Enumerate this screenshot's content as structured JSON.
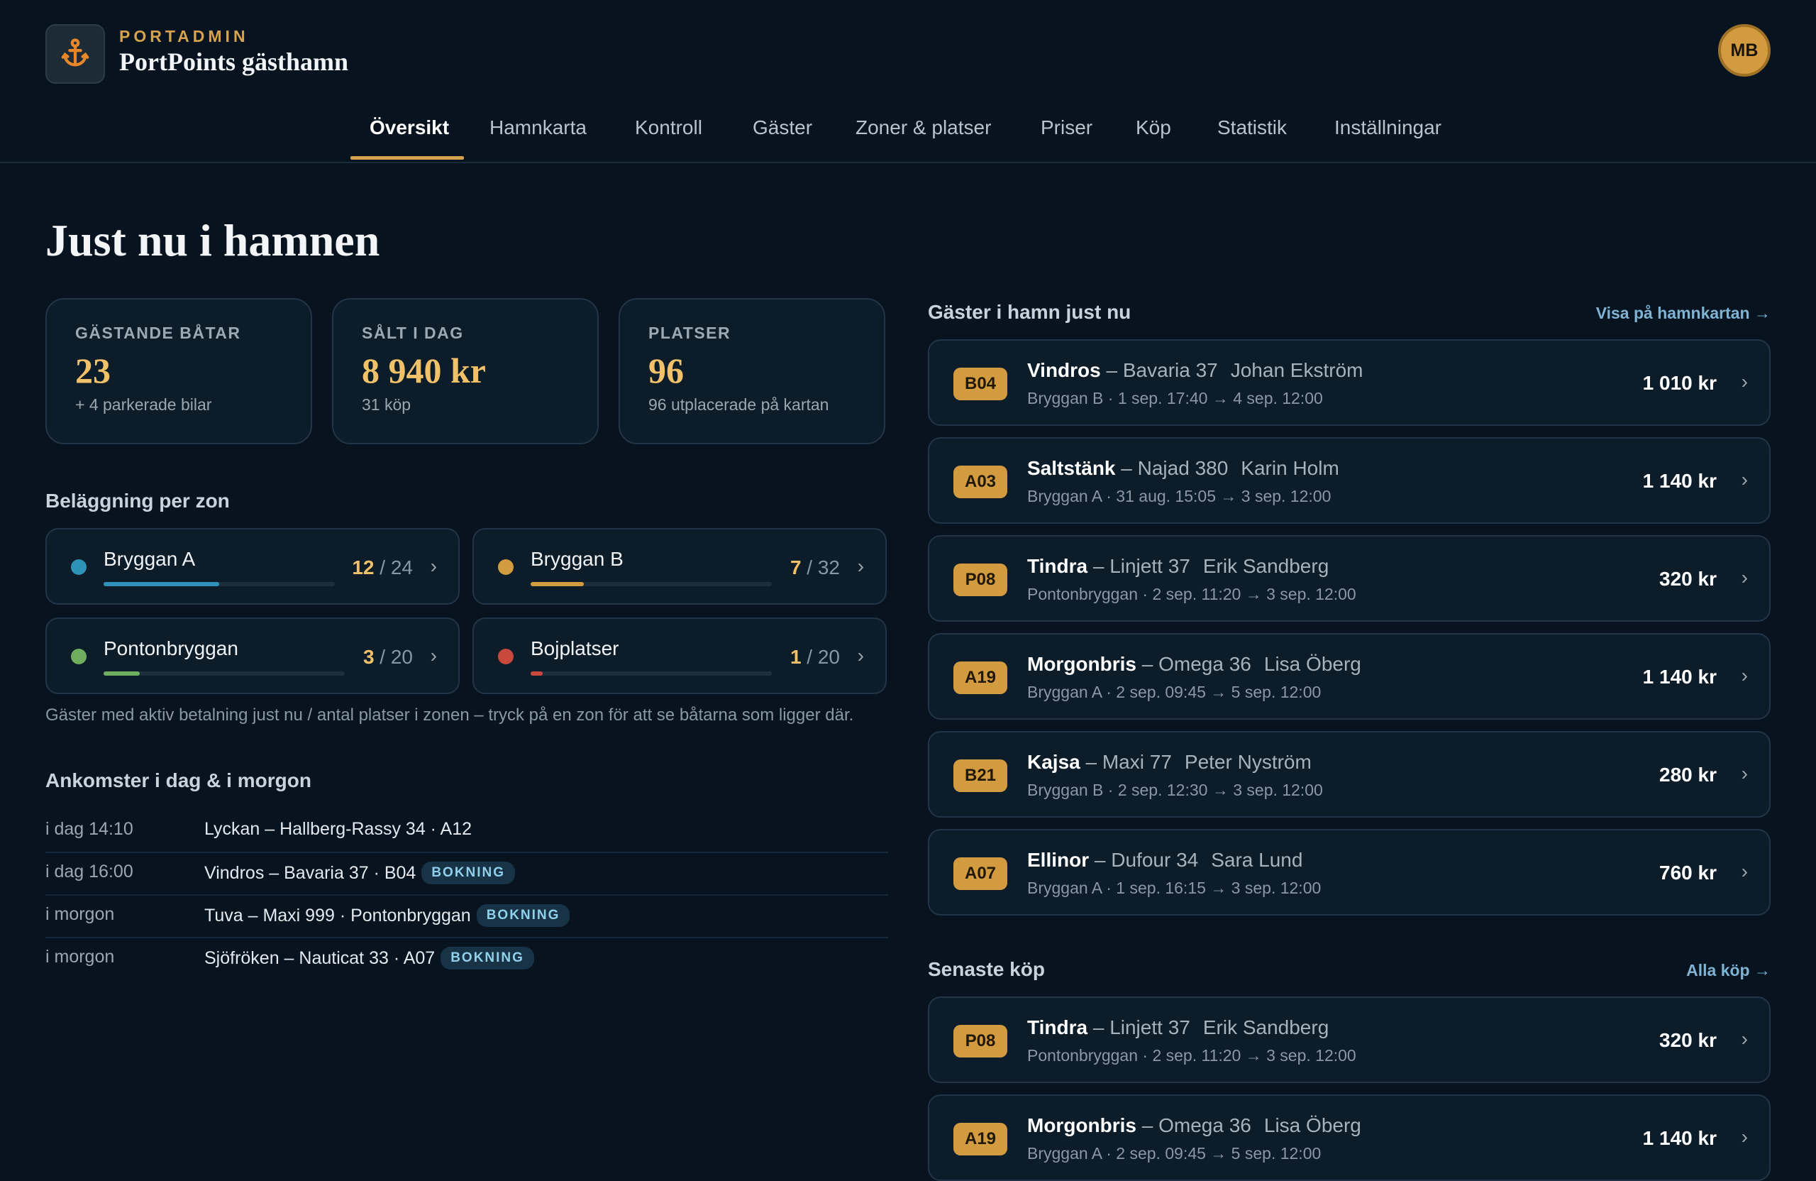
{
  "header": {
    "brand_top": "PORTADMIN",
    "brand_name": "PortPoints gästhamn",
    "avatar_initials": "MB",
    "logo_icon": "anchor-icon"
  },
  "nav": {
    "active": "Översikt",
    "items": [
      "Översikt",
      "Hamnkarta",
      "Kontroll",
      "Gäster",
      "Zoner & platser",
      "Priser",
      "Köp",
      "Statistik",
      "Inställningar"
    ]
  },
  "page_title": "Just nu i hamnen",
  "stats": [
    {
      "label": "GÄSTANDE BÅTAR",
      "value": "23",
      "sub": "+ 4 parkerade bilar"
    },
    {
      "label": "SÅLT I DAG",
      "value": "8 940 kr",
      "sub": "31 köp"
    },
    {
      "label": "PLATSER",
      "value": "96",
      "sub": "96 utplacerade på kartan"
    }
  ],
  "zones": {
    "title": "Beläggning per zon",
    "items": [
      {
        "name": "Bryggan A",
        "used": "12",
        "total": "/ 24",
        "color": "#2f93b8",
        "fill_fraction": 0.5
      },
      {
        "name": "Bryggan B",
        "used": "7",
        "total": "/ 32",
        "color": "#d39b3f",
        "fill_fraction": 0.22
      },
      {
        "name": "Pontonbryggan",
        "used": "3",
        "total": "/ 20",
        "color": "#6fae5f",
        "fill_fraction": 0.15
      },
      {
        "name": "Bojplatser",
        "used": "1",
        "total": "/ 20",
        "color": "#c94a3c",
        "fill_fraction": 0.05
      }
    ],
    "note": "Gäster med aktiv betalning just nu / antal platser i zonen – tryck på en zon för att se båtarna som ligger där."
  },
  "arrivals": {
    "title": "Ankomster i dag & i morgon",
    "rows": [
      {
        "when": "i dag 14:10",
        "what": "Lyckan – Hallberg-Rassy 34 · A12",
        "tag": ""
      },
      {
        "when": "i dag 16:00",
        "what": "Vindros – Bavaria 37 · B04",
        "tag": "BOKNING"
      },
      {
        "when": "i morgon",
        "what": "Tuva – Maxi 999 · Pontonbryggan",
        "tag": "BOKNING"
      },
      {
        "when": "i morgon",
        "what": "Sjöfröken – Nauticat 33 · A07",
        "tag": "BOKNING"
      }
    ]
  },
  "guests_now": {
    "title": "Gäster i hamn just nu",
    "link": "Visa på hamnkartan →",
    "items": [
      {
        "spot": "B04",
        "boat": "Vindros",
        "model": "– Bavaria 37",
        "owner": "Johan Ekström",
        "detail": "Bryggan B · 1 sep. 17:40 → 4 sep. 12:00",
        "price": "1 010 kr"
      },
      {
        "spot": "A03",
        "boat": "Saltstänk",
        "model": "– Najad 380",
        "owner": "Karin Holm",
        "detail": "Bryggan A · 31 aug. 15:05 → 3 sep. 12:00",
        "price": "1 140 kr"
      },
      {
        "spot": "P08",
        "boat": "Tindra",
        "model": "– Linjett 37",
        "owner": "Erik Sandberg",
        "detail": "Pontonbryggan · 2 sep. 11:20 → 3 sep. 12:00",
        "price": "320 kr"
      },
      {
        "spot": "A19",
        "boat": "Morgonbris",
        "model": "– Omega 36",
        "owner": "Lisa Öberg",
        "detail": "Bryggan A · 2 sep. 09:45 → 5 sep. 12:00",
        "price": "1 140 kr"
      },
      {
        "spot": "B21",
        "boat": "Kajsa",
        "model": "– Maxi 77",
        "owner": "Peter Nyström",
        "detail": "Bryggan B · 2 sep. 12:30 → 3 sep. 12:00",
        "price": "280 kr"
      },
      {
        "spot": "A07",
        "boat": "Ellinor",
        "model": "– Dufour 34",
        "owner": "Sara Lund",
        "detail": "Bryggan A · 1 sep. 16:15 → 3 sep. 12:00",
        "price": "760 kr"
      }
    ]
  },
  "recent": {
    "title": "Senaste köp",
    "link": "Alla köp →",
    "items": [
      {
        "spot": "P08",
        "boat": "Tindra",
        "model": "– Linjett 37",
        "owner": "Erik Sandberg",
        "detail": "Pontonbryggan · 2 sep. 11:20 → 3 sep. 12:00",
        "price": "320 kr"
      },
      {
        "spot": "A19",
        "boat": "Morgonbris",
        "model": "– Omega 36",
        "owner": "Lisa Öberg",
        "detail": "Bryggan A · 2 sep. 09:45 → 5 sep. 12:00",
        "price": "1 140 kr"
      }
    ]
  }
}
